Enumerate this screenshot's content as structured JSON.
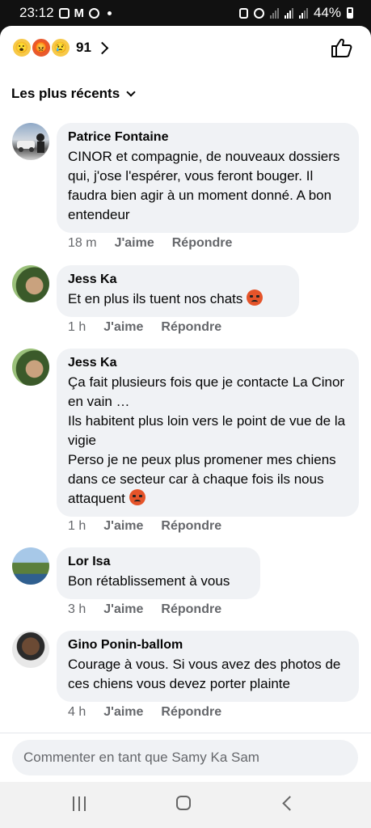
{
  "status_bar": {
    "time": "23:12",
    "battery": "44%"
  },
  "reactions": {
    "emojis": [
      "wow-emoji",
      "angry-emoji",
      "sad-emoji"
    ],
    "count": "91"
  },
  "sort": {
    "label": "Les plus récents"
  },
  "comments": [
    {
      "author": "Patrice Fontaine",
      "text": "CINOR et compagnie, de nouveaux dossiers qui, j'ose l'espérer, vous feront bouger. Il faudra bien agir à un moment donné. A bon entendeur",
      "time": "18 m",
      "like": "J'aime",
      "reply": "Répondre"
    },
    {
      "author": "Jess Ka",
      "text": "Et en plus ils tuent nos chats",
      "time": "1 h",
      "like": "J'aime",
      "reply": "Répondre"
    },
    {
      "author": "Jess Ka",
      "text_lines": [
        "Ça fait plusieurs fois que je contacte La Cinor en vain …",
        "Ils habitent plus loin vers le point de vue de la vigie",
        "Perso je ne peux plus promener mes chiens dans ce secteur car à chaque fois ils nous attaquent"
      ],
      "time": "1 h",
      "like": "J'aime",
      "reply": "Répondre"
    },
    {
      "author": "Lor Isa",
      "text": "Bon rétablissement à vous",
      "time": "3 h",
      "like": "J'aime",
      "reply": "Répondre"
    },
    {
      "author": "Gino Ponin-ballom",
      "text": "Courage à vous. Si vous avez des photos de ces chiens vous devez porter plainte",
      "time": "4 h",
      "like": "J'aime",
      "reply": "Répondre"
    }
  ],
  "composer": {
    "placeholder": "Commenter en tant que Samy Ka Sam"
  },
  "colors": {
    "bubble": "#f0f2f5",
    "meta": "#65676b",
    "text": "#050505"
  }
}
